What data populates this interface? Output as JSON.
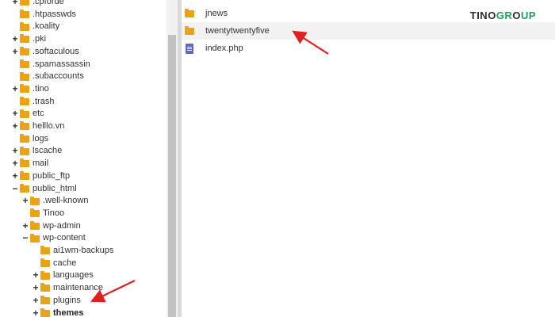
{
  "tree": {
    "items": [
      {
        "label": ".cpforde",
        "toggle": "+",
        "depth": 0,
        "bold": false
      },
      {
        "label": ".htpasswds",
        "toggle": "",
        "depth": 0,
        "bold": false
      },
      {
        "label": ".koality",
        "toggle": "",
        "depth": 0,
        "bold": false
      },
      {
        "label": ".pki",
        "toggle": "+",
        "depth": 0,
        "bold": false
      },
      {
        "label": ".softaculous",
        "toggle": "+",
        "depth": 0,
        "bold": false
      },
      {
        "label": ".spamassassin",
        "toggle": "",
        "depth": 0,
        "bold": false
      },
      {
        "label": ".subaccounts",
        "toggle": "",
        "depth": 0,
        "bold": false
      },
      {
        "label": ".tino",
        "toggle": "+",
        "depth": 0,
        "bold": false
      },
      {
        "label": ".trash",
        "toggle": "",
        "depth": 0,
        "bold": false
      },
      {
        "label": "etc",
        "toggle": "+",
        "depth": 0,
        "bold": false
      },
      {
        "label": "helllo.vn",
        "toggle": "+",
        "depth": 0,
        "bold": false
      },
      {
        "label": "logs",
        "toggle": "",
        "depth": 0,
        "bold": false
      },
      {
        "label": "lscache",
        "toggle": "+",
        "depth": 0,
        "bold": false
      },
      {
        "label": "mail",
        "toggle": "+",
        "depth": 0,
        "bold": false
      },
      {
        "label": "public_ftp",
        "toggle": "+",
        "depth": 0,
        "bold": false
      },
      {
        "label": "public_html",
        "toggle": "−",
        "depth": 0,
        "bold": false
      },
      {
        "label": ".well-known",
        "toggle": "+",
        "depth": 1,
        "bold": false
      },
      {
        "label": "Tinoo",
        "toggle": "",
        "depth": 1,
        "bold": false
      },
      {
        "label": "wp-admin",
        "toggle": "+",
        "depth": 1,
        "bold": false
      },
      {
        "label": "wp-content",
        "toggle": "−",
        "depth": 1,
        "bold": false
      },
      {
        "label": "ai1wm-backups",
        "toggle": "",
        "depth": 2,
        "bold": false
      },
      {
        "label": "cache",
        "toggle": "",
        "depth": 2,
        "bold": false
      },
      {
        "label": "languages",
        "toggle": "+",
        "depth": 2,
        "bold": false
      },
      {
        "label": "maintenance",
        "toggle": "+",
        "depth": 2,
        "bold": false
      },
      {
        "label": "plugins",
        "toggle": "+",
        "depth": 2,
        "bold": false
      },
      {
        "label": "themes",
        "toggle": "+",
        "depth": 2,
        "bold": true
      }
    ]
  },
  "files": {
    "rows": [
      {
        "name": "jnews",
        "type": "folder",
        "highlighted": false
      },
      {
        "name": "twentytwentyfive",
        "type": "folder",
        "highlighted": true
      },
      {
        "name": "index.php",
        "type": "file",
        "highlighted": false
      }
    ]
  },
  "logo": {
    "part1": "TINO",
    "part2": "GR",
    "part3": "O",
    "part4": "UP"
  },
  "colors": {
    "folder": "#e8a317",
    "arrow": "#e02020",
    "accent": "#1aa25a",
    "file_icon": "#5b6bbf"
  }
}
